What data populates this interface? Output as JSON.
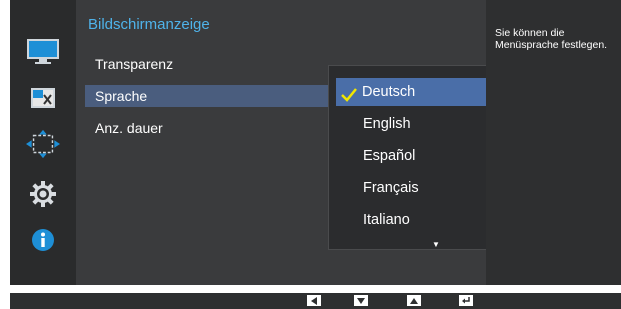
{
  "main": {
    "title": "Bildschirmanzeige",
    "items": [
      {
        "label": "Transparenz"
      },
      {
        "label": "Sprache"
      },
      {
        "label": "Anz. dauer"
      }
    ]
  },
  "dropdown": {
    "selected": "Deutsch",
    "options": [
      {
        "label": "Deutsch"
      },
      {
        "label": "English"
      },
      {
        "label": "Español"
      },
      {
        "label": "Français"
      },
      {
        "label": "Italiano"
      }
    ]
  },
  "info": {
    "text": "Sie können die Menüsprache festlegen."
  },
  "sidebar": {
    "icons": [
      "picture-icon",
      "screen-adjust-icon",
      "position-icon",
      "gear-icon",
      "info-icon"
    ]
  },
  "bottombar": {
    "keys": [
      "left-arrow-key-icon",
      "down-arrow-key-icon",
      "up-arrow-key-icon",
      "enter-key-icon"
    ]
  },
  "colors": {
    "accent": "#4fb3ea",
    "selection": "#4a6ea8",
    "check": "#f2e600"
  }
}
